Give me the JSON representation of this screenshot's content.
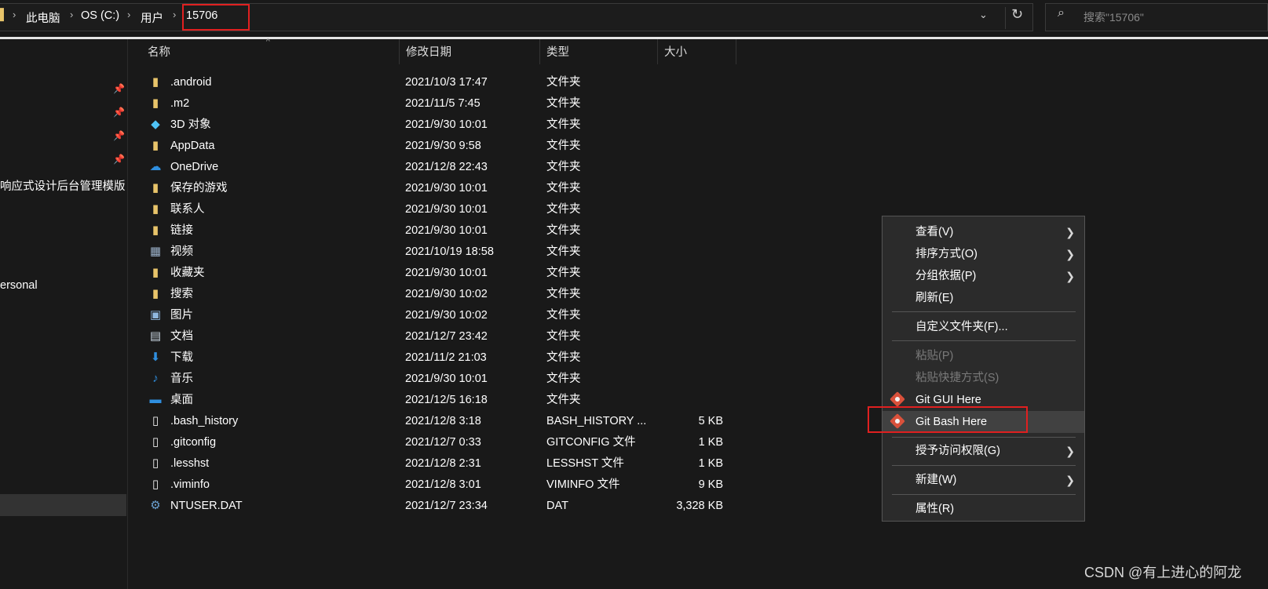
{
  "address": {
    "crumbs": [
      "此电脑",
      "OS (C:)",
      "用户",
      "15706"
    ],
    "search_placeholder": "搜索\"15706\""
  },
  "nav": {
    "items": [
      {
        "label": "响应式设计后台管理模版"
      },
      {
        "label": "ersonal"
      }
    ]
  },
  "columns": {
    "name": "名称",
    "date": "修改日期",
    "type": "类型",
    "size": "大小"
  },
  "files": [
    {
      "icon": "folder-icon",
      "name": ".android",
      "date": "2021/10/3 17:47",
      "type": "文件夹",
      "size": ""
    },
    {
      "icon": "folder-icon",
      "name": ".m2",
      "date": "2021/11/5 7:45",
      "type": "文件夹",
      "size": ""
    },
    {
      "icon": "3d-objects-icon",
      "name": "3D 对象",
      "date": "2021/9/30 10:01",
      "type": "文件夹",
      "size": ""
    },
    {
      "icon": "folder-icon",
      "name": "AppData",
      "date": "2021/9/30 9:58",
      "type": "文件夹",
      "size": ""
    },
    {
      "icon": "onedrive-icon",
      "name": "OneDrive",
      "date": "2021/12/8 22:43",
      "type": "文件夹",
      "size": ""
    },
    {
      "icon": "saved-games-icon",
      "name": "保存的游戏",
      "date": "2021/9/30 10:01",
      "type": "文件夹",
      "size": ""
    },
    {
      "icon": "contacts-icon",
      "name": "联系人",
      "date": "2021/9/30 10:01",
      "type": "文件夹",
      "size": ""
    },
    {
      "icon": "links-icon",
      "name": "链接",
      "date": "2021/9/30 10:01",
      "type": "文件夹",
      "size": ""
    },
    {
      "icon": "videos-icon",
      "name": "视频",
      "date": "2021/10/19 18:58",
      "type": "文件夹",
      "size": ""
    },
    {
      "icon": "favorites-icon",
      "name": "收藏夹",
      "date": "2021/9/30 10:01",
      "type": "文件夹",
      "size": ""
    },
    {
      "icon": "searches-icon",
      "name": "搜索",
      "date": "2021/9/30 10:02",
      "type": "文件夹",
      "size": ""
    },
    {
      "icon": "pictures-icon",
      "name": "图片",
      "date": "2021/9/30 10:02",
      "type": "文件夹",
      "size": ""
    },
    {
      "icon": "documents-icon",
      "name": "文档",
      "date": "2021/12/7 23:42",
      "type": "文件夹",
      "size": ""
    },
    {
      "icon": "downloads-icon",
      "name": "下载",
      "date": "2021/11/2 21:03",
      "type": "文件夹",
      "size": ""
    },
    {
      "icon": "music-icon",
      "name": "音乐",
      "date": "2021/9/30 10:01",
      "type": "文件夹",
      "size": ""
    },
    {
      "icon": "desktop-icon",
      "name": "桌面",
      "date": "2021/12/5 16:18",
      "type": "文件夹",
      "size": ""
    },
    {
      "icon": "file-icon",
      "name": ".bash_history",
      "date": "2021/12/8 3:18",
      "type": "BASH_HISTORY ...",
      "size": "5 KB"
    },
    {
      "icon": "file-icon",
      "name": ".gitconfig",
      "date": "2021/12/7 0:33",
      "type": "GITCONFIG 文件",
      "size": "1 KB"
    },
    {
      "icon": "file-icon",
      "name": ".lesshst",
      "date": "2021/12/8 2:31",
      "type": "LESSHST 文件",
      "size": "1 KB"
    },
    {
      "icon": "file-icon",
      "name": ".viminfo",
      "date": "2021/12/8 3:01",
      "type": "VIMINFO 文件",
      "size": "9 KB"
    },
    {
      "icon": "system-file-icon",
      "name": "NTUSER.DAT",
      "date": "2021/12/7 23:34",
      "type": "DAT",
      "size": "3,328 KB"
    }
  ],
  "context_menu": {
    "view": "查看(V)",
    "sort_by": "排序方式(O)",
    "group_by": "分组依据(P)",
    "refresh": "刷新(E)",
    "customize": "自定义文件夹(F)...",
    "paste": "粘贴(P)",
    "paste_shortcut": "粘贴快捷方式(S)",
    "git_gui": "Git GUI Here",
    "git_bash": "Git Bash Here",
    "give_access": "授予访问权限(G)",
    "new": "新建(W)",
    "properties": "属性(R)"
  },
  "watermark": "CSDN @有上进心的阿龙",
  "colors": {
    "highlight_box": "#e02020",
    "background": "#191919",
    "menu_bg": "#2b2b2b"
  }
}
